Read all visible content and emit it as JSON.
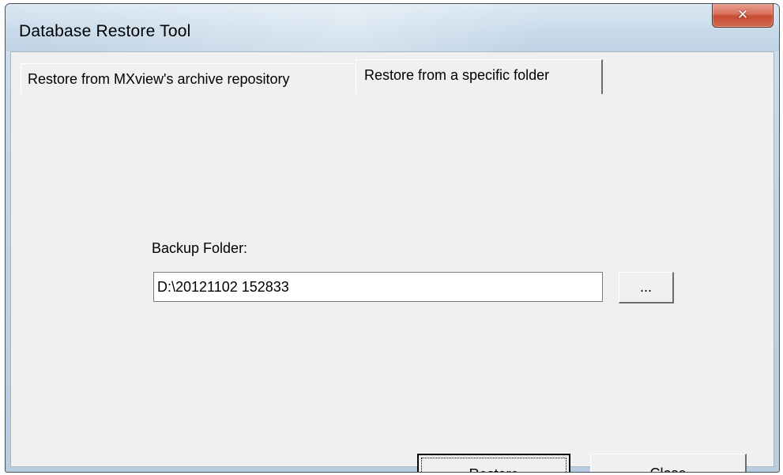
{
  "window": {
    "title": "Database Restore Tool",
    "close_glyph": "✕",
    "close_icon": "close-icon"
  },
  "tabs": [
    {
      "label": "Restore from MXview's archive repository",
      "active": false
    },
    {
      "label": "Restore from a specific folder",
      "active": true
    }
  ],
  "panel": {
    "backup_folder_label": "Backup Folder:",
    "backup_folder_value": "D:\\20121102 152833",
    "browse_label": "...",
    "restore_label": "Restore",
    "close_label": "Close"
  },
  "colors": {
    "close_button": "#c54a32",
    "dialog_background": "#f0f0f0"
  }
}
